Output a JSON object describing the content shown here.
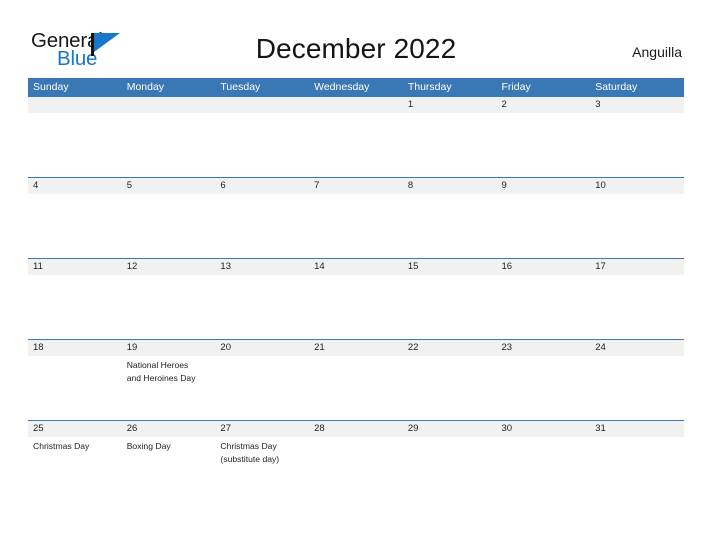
{
  "header": {
    "logo": {
      "text_primary": "General",
      "text_secondary": "Blue",
      "icon": "flag-icon"
    },
    "title": "December 2022",
    "locale": "Anguilla"
  },
  "colors": {
    "header_blue": "#3a77b5",
    "logo_blue": "#1a76c8",
    "date_row_bg": "#f1f1f1",
    "text": "#1f1f1f"
  },
  "calendar": {
    "day_headers": [
      "Sunday",
      "Monday",
      "Tuesday",
      "Wednesday",
      "Thursday",
      "Friday",
      "Saturday"
    ],
    "weeks": [
      {
        "dates": [
          "",
          "",
          "",
          "",
          "1",
          "2",
          "3"
        ],
        "events": [
          [],
          [],
          [],
          [],
          [],
          [],
          []
        ]
      },
      {
        "dates": [
          "4",
          "5",
          "6",
          "7",
          "8",
          "9",
          "10"
        ],
        "events": [
          [],
          [],
          [],
          [],
          [],
          [],
          []
        ]
      },
      {
        "dates": [
          "11",
          "12",
          "13",
          "14",
          "15",
          "16",
          "17"
        ],
        "events": [
          [],
          [],
          [],
          [],
          [],
          [],
          []
        ]
      },
      {
        "dates": [
          "18",
          "19",
          "20",
          "21",
          "22",
          "23",
          "24"
        ],
        "events": [
          [],
          [
            "National Heroes",
            "and Heroines Day"
          ],
          [],
          [],
          [],
          [],
          []
        ]
      },
      {
        "dates": [
          "25",
          "26",
          "27",
          "28",
          "29",
          "30",
          "31"
        ],
        "events": [
          [
            "Christmas Day"
          ],
          [
            "Boxing Day"
          ],
          [
            "Christmas Day",
            "(substitute day)"
          ],
          [],
          [],
          [],
          []
        ]
      }
    ]
  }
}
